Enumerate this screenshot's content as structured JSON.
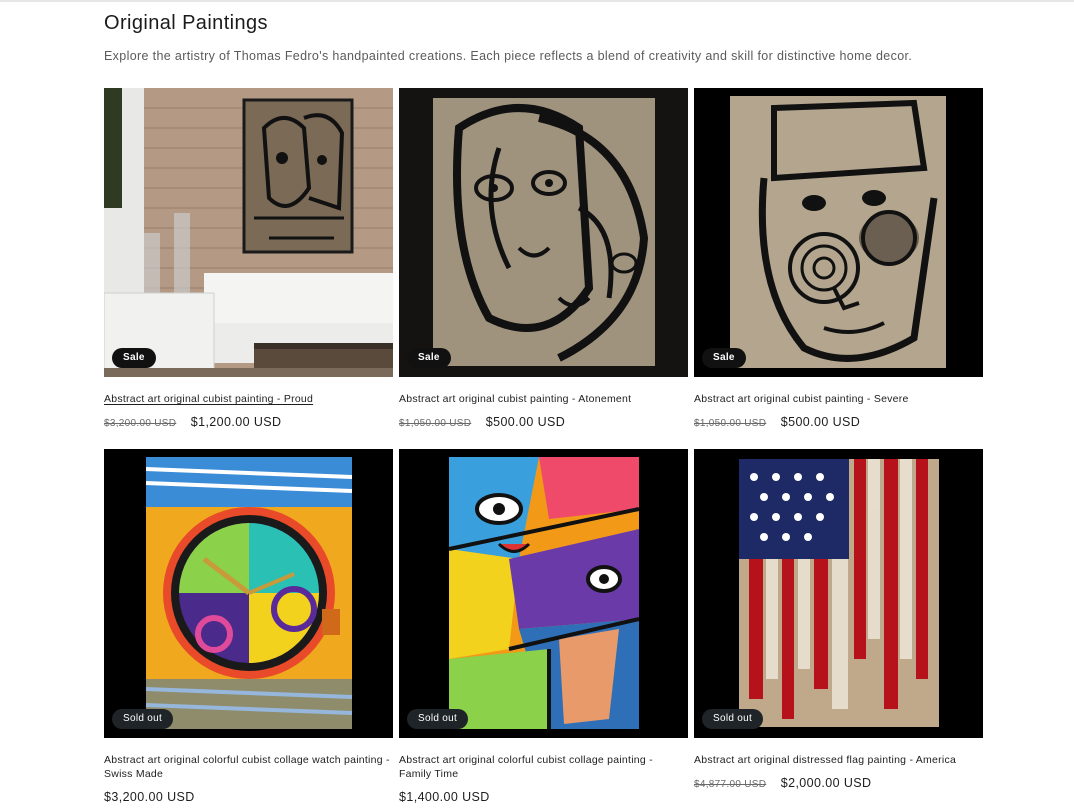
{
  "collection": {
    "title": "Original Paintings",
    "description": "Explore the artistry of Thomas Fedro's handpainted creations. Each piece reflects a blend of creativity and skill for distinctive home decor."
  },
  "products": [
    {
      "name": "Abstract art original cubist painting - Proud",
      "badge": "Sale",
      "compare_price": "$3,200.00 USD",
      "price": "$1,200.00 USD"
    },
    {
      "name": "Abstract art original cubist painting - Atonement",
      "badge": "Sale",
      "compare_price": "$1,050.00 USD",
      "price": "$500.00 USD"
    },
    {
      "name": "Abstract art original cubist painting - Severe",
      "badge": "Sale",
      "compare_price": "$1,050.00 USD",
      "price": "$500.00 USD"
    },
    {
      "name": "Abstract art original colorful cubist collage watch painting - Swiss Made",
      "badge": "Sold out",
      "compare_price": "",
      "price": "$3,200.00 USD"
    },
    {
      "name": "Abstract art original colorful cubist collage painting - Family Time",
      "badge": "Sold out",
      "compare_price": "",
      "price": "$1,400.00 USD"
    },
    {
      "name": "Abstract art original distressed flag painting - America",
      "badge": "Sold out",
      "compare_price": "$4,877.00 USD",
      "price": "$2,000.00 USD"
    }
  ]
}
